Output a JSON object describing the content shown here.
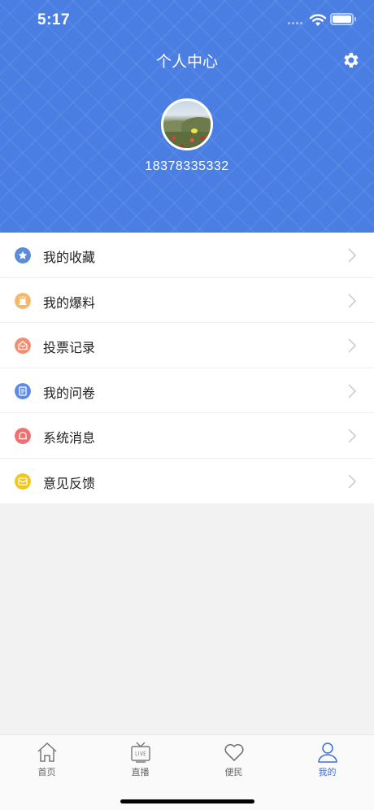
{
  "status_bar": {
    "time": "5:17"
  },
  "header": {
    "title": "个人中心",
    "phone": "18378335332"
  },
  "menu": [
    {
      "label": "我的收藏",
      "icon": "star-icon",
      "color": "#5b8bd9"
    },
    {
      "label": "我的爆料",
      "icon": "megaphone-icon",
      "color": "#f4b86b"
    },
    {
      "label": "投票记录",
      "icon": "ballot-icon",
      "color": "#f28e73"
    },
    {
      "label": "我的问卷",
      "icon": "document-icon",
      "color": "#5b8be6"
    },
    {
      "label": "系统消息",
      "icon": "bell-icon",
      "color": "#f07070"
    },
    {
      "label": "意见反馈",
      "icon": "feedback-icon",
      "color": "#f5c518"
    }
  ],
  "tabs": [
    {
      "label": "首页",
      "icon": "home-icon"
    },
    {
      "label": "直播",
      "icon": "tv-icon"
    },
    {
      "label": "便民",
      "icon": "heart-icon"
    },
    {
      "label": "我的",
      "icon": "person-icon",
      "active": true
    }
  ],
  "colors": {
    "brand_blue": "#4a7ee3",
    "active_tab": "#3b6fd8"
  }
}
